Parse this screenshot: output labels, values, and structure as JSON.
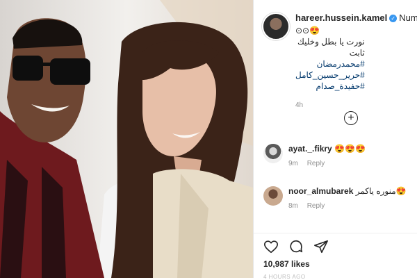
{
  "post": {
    "author": {
      "username": "hareer.hussein.kamel",
      "verified": true,
      "follow_text": "Number"
    },
    "caption_lines": [
      "⊙⊙😍",
      "نورت يا بطل وخليك ثابت",
      "#محمدرمضان",
      "#حرير_حسين_كامل",
      "#حفيدة_صدام"
    ],
    "time_ago": "4h",
    "likes": "10,987 likes",
    "date": "4 HOURS AGO"
  },
  "comments": [
    {
      "username": "ayat._.fikry",
      "text": "😍😍😍",
      "time": "9m",
      "reply_label": "Reply"
    },
    {
      "username": "noor_almubarek",
      "text": "منوره ياكمر😍",
      "time": "8m",
      "reply_label": "Reply"
    }
  ],
  "icons": {
    "load_more": "plus-circle-icon",
    "like": "heart-icon",
    "comment": "comment-icon",
    "share": "share-icon"
  }
}
